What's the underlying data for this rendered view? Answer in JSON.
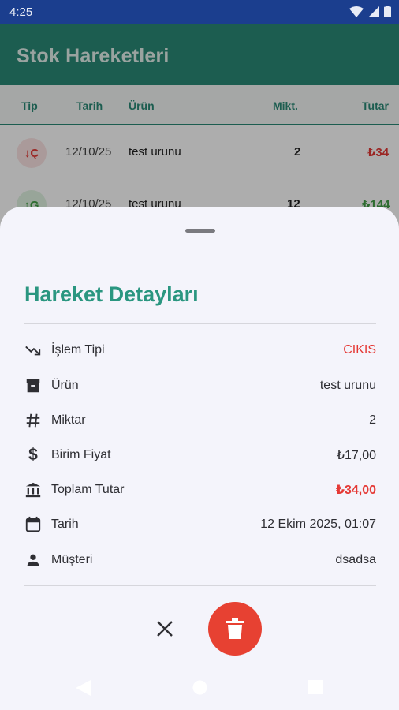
{
  "status_bar": {
    "time": "4:25"
  },
  "app_bar": {
    "title": "Stok Hareketleri"
  },
  "table": {
    "headers": {
      "type": "Tip",
      "date": "Tarih",
      "product": "Ürün",
      "qty": "Mikt.",
      "amount": "Tutar"
    },
    "rows": [
      {
        "type": "↓Ç",
        "date": "12/10/25",
        "product": "test urunu",
        "qty": "2",
        "amount": "₺34",
        "color": "#e53935",
        "badge_bg": "#fbe3e3"
      },
      {
        "type": "↑G",
        "date": "12/10/25",
        "product": "test urunu",
        "qty": "12",
        "amount": "₺144",
        "color": "#43a047",
        "badge_bg": "#e1f3e2"
      }
    ]
  },
  "sheet": {
    "title": "Hareket Detayları",
    "rows": [
      {
        "icon": "trending-down-icon",
        "label": "İşlem Tipi",
        "value": "CIKIS",
        "value_color": "#e53935"
      },
      {
        "icon": "archive-box-icon",
        "label": "Ürün",
        "value": "test urunu",
        "value_color": "#2e2e33"
      },
      {
        "icon": "hash-icon",
        "label": "Miktar",
        "value": "2",
        "value_color": "#2e2e33"
      },
      {
        "icon": "dollar-icon",
        "label": "Birim Fiyat",
        "value": "₺17,00",
        "value_color": "#2e2e33"
      },
      {
        "icon": "bank-icon",
        "label": "Toplam Tutar",
        "value": "₺34,00",
        "value_color": "#e53935"
      },
      {
        "icon": "calendar-icon",
        "label": "Tarih",
        "value": "12 Ekim 2025, 01:07",
        "value_color": "#2e2e33"
      },
      {
        "icon": "person-icon",
        "label": "Müşteri",
        "value": "dsadsa",
        "value_color": "#2e2e33"
      }
    ],
    "close_icon": "close-icon",
    "delete_icon": "trash-icon",
    "delete_color": "#e74132"
  },
  "nav_bar": {
    "icons": [
      "back-icon",
      "home-icon",
      "recents-icon"
    ]
  }
}
